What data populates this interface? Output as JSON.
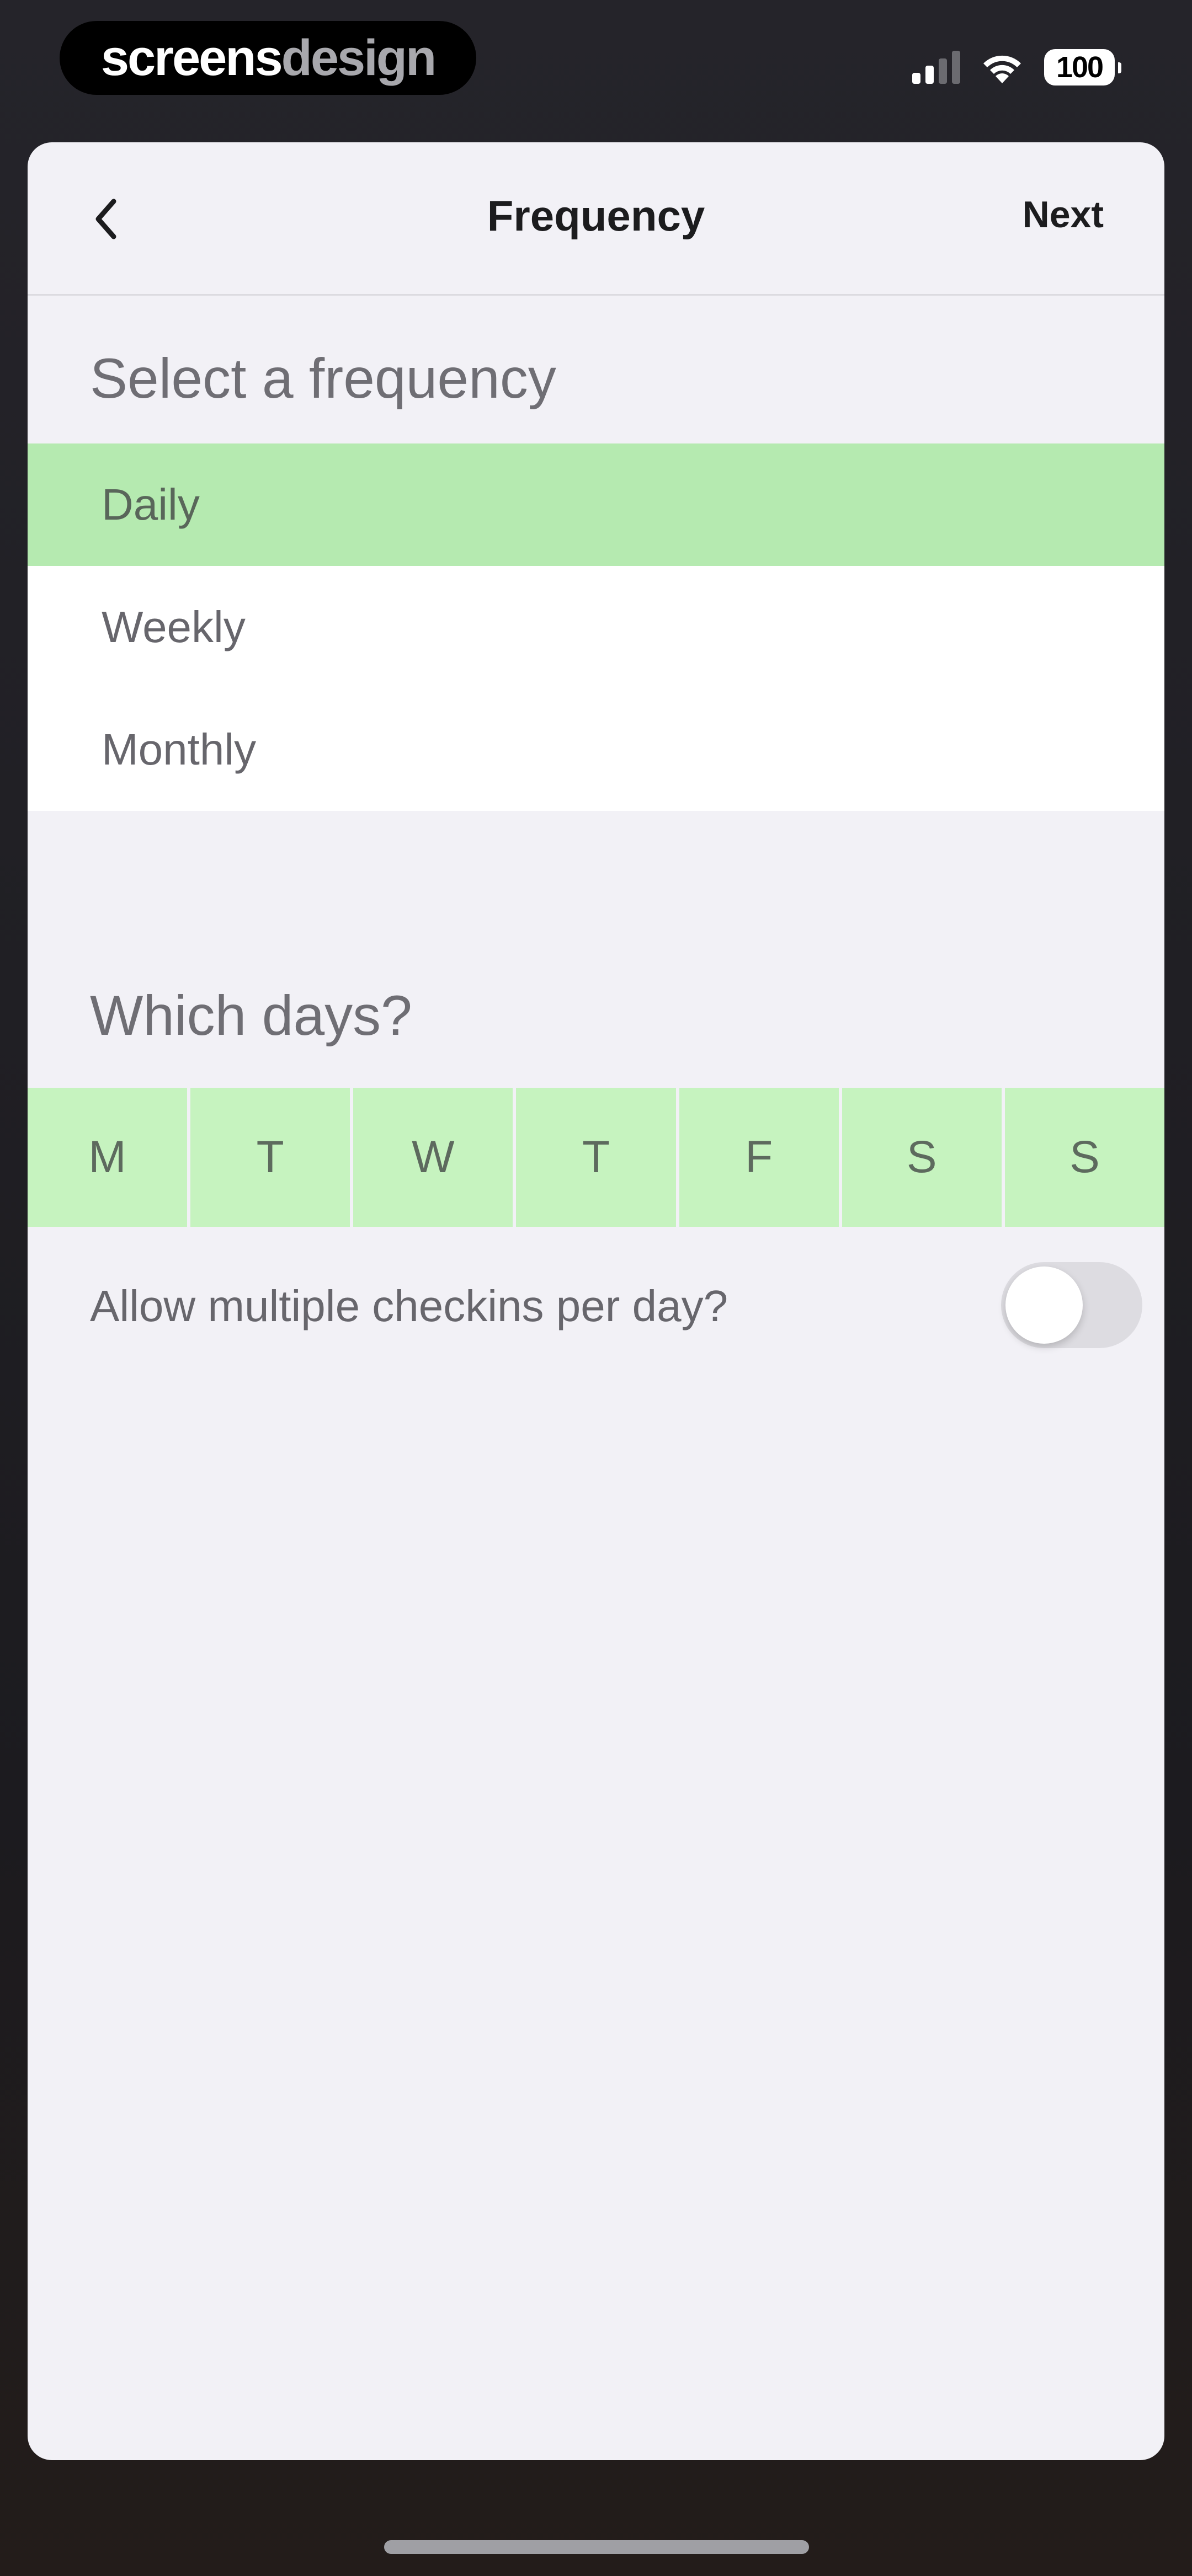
{
  "status_bar": {
    "brand_bold": "screens",
    "brand_light": "design",
    "battery": "100",
    "icons": [
      "signal-icon",
      "wifi-icon",
      "battery-icon"
    ]
  },
  "navbar": {
    "back_icon": "chevron-left-icon",
    "title": "Frequency",
    "next_label": "Next"
  },
  "frequency": {
    "header": "Select a frequency",
    "options": [
      {
        "label": "Daily",
        "selected": true
      },
      {
        "label": "Weekly",
        "selected": false
      },
      {
        "label": "Monthly",
        "selected": false
      }
    ]
  },
  "days": {
    "header": "Which days?",
    "items": [
      "M",
      "T",
      "W",
      "T",
      "F",
      "S",
      "S"
    ]
  },
  "multiple_checkins": {
    "label": "Allow multiple checkins per day?",
    "enabled": false
  },
  "colors": {
    "selected_row": "#b5eab0",
    "day_cell": "#c6f3bf",
    "sheet_bg": "#f2f1f6"
  }
}
